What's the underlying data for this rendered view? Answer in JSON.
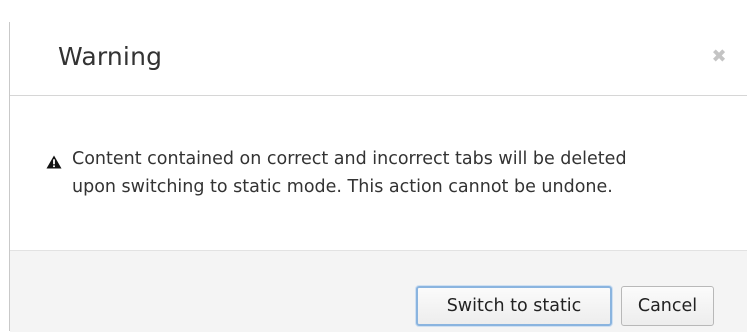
{
  "dialog": {
    "title": "Warning",
    "close_icon": "close-icon",
    "message_icon": "warning-triangle-icon",
    "message_line1": "Content contained on correct and incorrect tabs will be deleted",
    "message_line2": "upon switching to static mode. This action cannot be undone.",
    "buttons": {
      "primary_label": "Switch to static",
      "cancel_label": "Cancel"
    }
  },
  "colors": {
    "primary_focus_border": "#8ab4df",
    "footer_background": "#f4f4f4",
    "text": "#333333"
  }
}
